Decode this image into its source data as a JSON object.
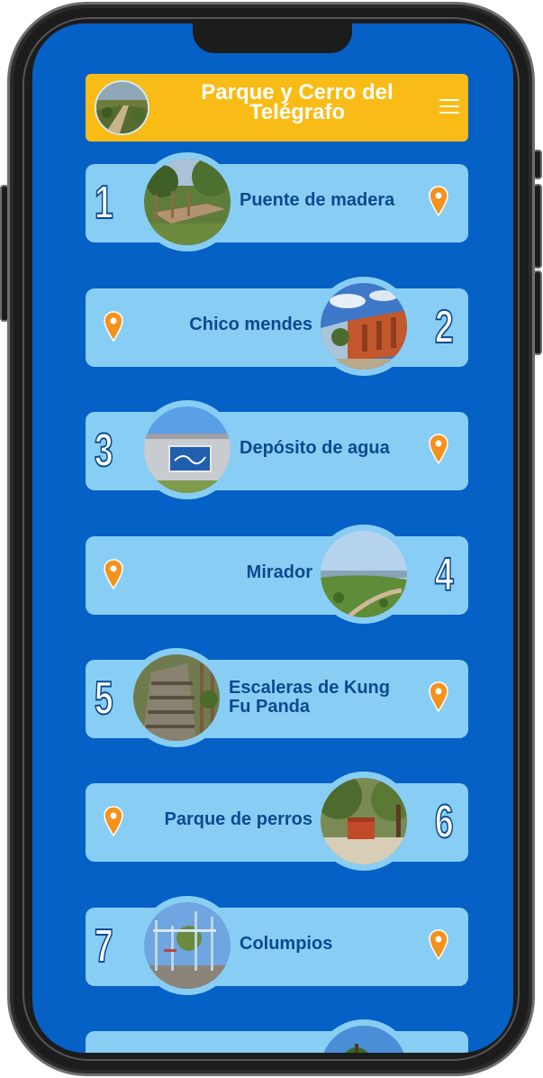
{
  "header": {
    "title": "Parque y Cerro del Telégrafo",
    "menu_icon": "hamburger-menu-icon",
    "colors": {
      "header_bg": "#f9bb15",
      "screen_bg": "#0561c6",
      "card_bg": "#88cef4",
      "label": "#0b4a8f",
      "pin": "#f5921e"
    }
  },
  "places": [
    {
      "number": "1",
      "name": "Puente de madera",
      "icon": "map-pin-icon"
    },
    {
      "number": "2",
      "name": "Chico mendes",
      "icon": "map-pin-icon"
    },
    {
      "number": "3",
      "name": "Depósito de agua",
      "icon": "map-pin-icon"
    },
    {
      "number": "4",
      "name": "Mirador",
      "icon": "map-pin-icon"
    },
    {
      "number": "5",
      "name": "Escaleras de Kung Fu Panda",
      "icon": "map-pin-icon"
    },
    {
      "number": "6",
      "name": "Parque de perros",
      "icon": "map-pin-icon"
    },
    {
      "number": "7",
      "name": "Columpios",
      "icon": "map-pin-icon"
    }
  ]
}
